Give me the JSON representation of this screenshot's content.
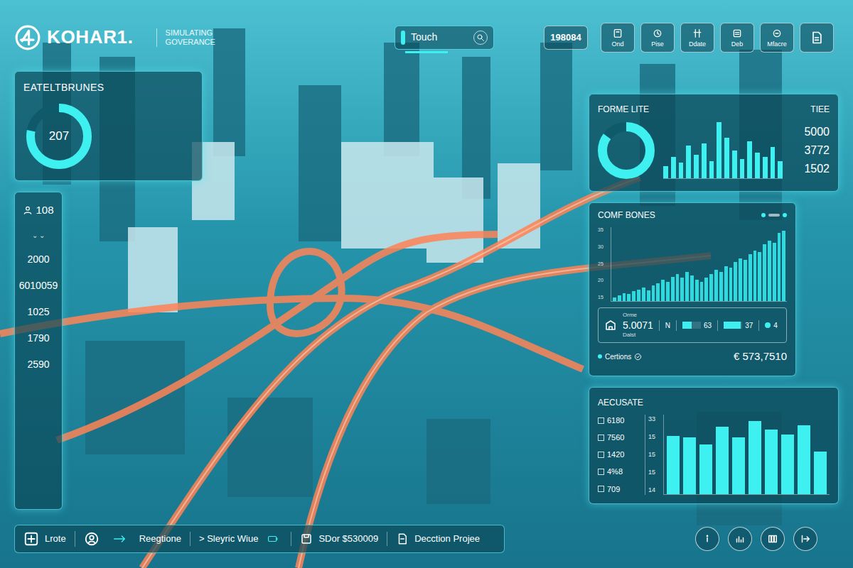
{
  "header": {
    "logo": "KOHAR1.",
    "tagline": [
      "SIMULATING",
      "GOVERANCE"
    ]
  },
  "search": {
    "value": "Touch"
  },
  "counter": "198084",
  "toolbar": [
    {
      "label": "Ond"
    },
    {
      "label": "Pise"
    },
    {
      "label": "Ddate"
    },
    {
      "label": "Deb"
    },
    {
      "label": "Mfacre"
    }
  ],
  "summary_panel": {
    "title": "EATELTBRUNES",
    "value": "207",
    "level": 0.78
  },
  "stats": [
    {
      "kind": "user",
      "value": "108"
    },
    {
      "kind": "marker",
      "value": "⌄ ⌄"
    },
    {
      "kind": "plain",
      "value": "2000"
    },
    {
      "kind": "plain",
      "value": "6010059"
    },
    {
      "kind": "plain",
      "value": "1025"
    },
    {
      "kind": "plain",
      "value": "1790"
    },
    {
      "kind": "plain",
      "value": "2590"
    }
  ],
  "forme_panel": {
    "title": "FORME LITE",
    "label": "TIEE",
    "level": 0.85,
    "bars": [
      22,
      38,
      28,
      58,
      42,
      62,
      30,
      100,
      72,
      50,
      34,
      66,
      46,
      38,
      56,
      30
    ],
    "readings": [
      "5000",
      "3772",
      "1502"
    ]
  },
  "comf_panel": {
    "title": "COMF BONES",
    "ticks": [
      "35",
      "30",
      "25",
      "20",
      "15"
    ],
    "bars": [
      4,
      6,
      8,
      7,
      10,
      12,
      14,
      11,
      16,
      18,
      22,
      20,
      25,
      28,
      24,
      30,
      26,
      22,
      20,
      24,
      28,
      32,
      30,
      36,
      34,
      40,
      44,
      42,
      48,
      52,
      50,
      58,
      62,
      60,
      70,
      72
    ],
    "table": {
      "caption_top": "Orme",
      "value": "5.0071",
      "caption_bottom": "Dalst",
      "cells": [
        {
          "kind": "text",
          "text": "N"
        },
        {
          "kind": "meter",
          "level": 0.5,
          "text": "63"
        },
        {
          "kind": "meter",
          "level": 0.9,
          "text": "37"
        },
        {
          "kind": "dot",
          "text": "4"
        }
      ]
    },
    "footer": {
      "label": "Certions",
      "total": "€ 573,7510"
    }
  },
  "aecus_panel": {
    "title": "AECUSATE",
    "rows": [
      {
        "value": "6180",
        "tick": "33"
      },
      {
        "value": "7560",
        "tick": "15"
      },
      {
        "value": "1420",
        "tick": "15"
      },
      {
        "value": "4%8",
        "tick": "15"
      },
      {
        "value": "709",
        "tick": "14"
      }
    ],
    "bars": [
      80,
      78,
      68,
      92,
      78,
      100,
      88,
      82,
      94,
      58
    ]
  },
  "bottom_bar": [
    {
      "label": "Lrote"
    },
    {
      "label": "Reegtione"
    },
    {
      "label": "> Sleyric Wiue"
    },
    {
      "label": "SDor $530009"
    },
    {
      "label": "Decction Projee"
    }
  ]
}
